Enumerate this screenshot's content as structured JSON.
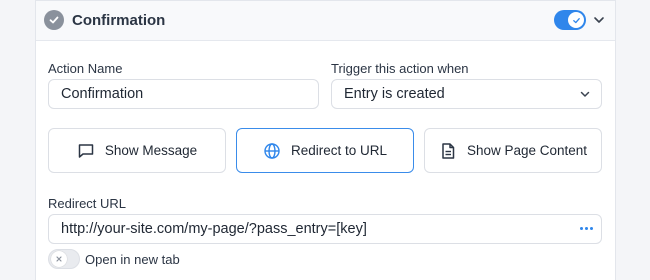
{
  "header": {
    "title": "Confirmation",
    "enabled": true
  },
  "action_name": {
    "label": "Action Name",
    "value": "Confirmation"
  },
  "trigger": {
    "label": "Trigger this action when",
    "selected": "Entry is created"
  },
  "action_types": [
    {
      "label": "Show Message",
      "icon": "message-icon",
      "active": false
    },
    {
      "label": "Redirect to URL",
      "icon": "globe-icon",
      "active": true
    },
    {
      "label": "Show Page Content",
      "icon": "document-icon",
      "active": false
    }
  ],
  "redirect": {
    "label": "Redirect URL",
    "value": "http://your-site.com/my-page/?pass_entry=[key]"
  },
  "new_tab": {
    "label": "Open in new tab",
    "enabled": false
  },
  "colors": {
    "accent": "#2f86eb",
    "check_circle": "#8a919c"
  }
}
